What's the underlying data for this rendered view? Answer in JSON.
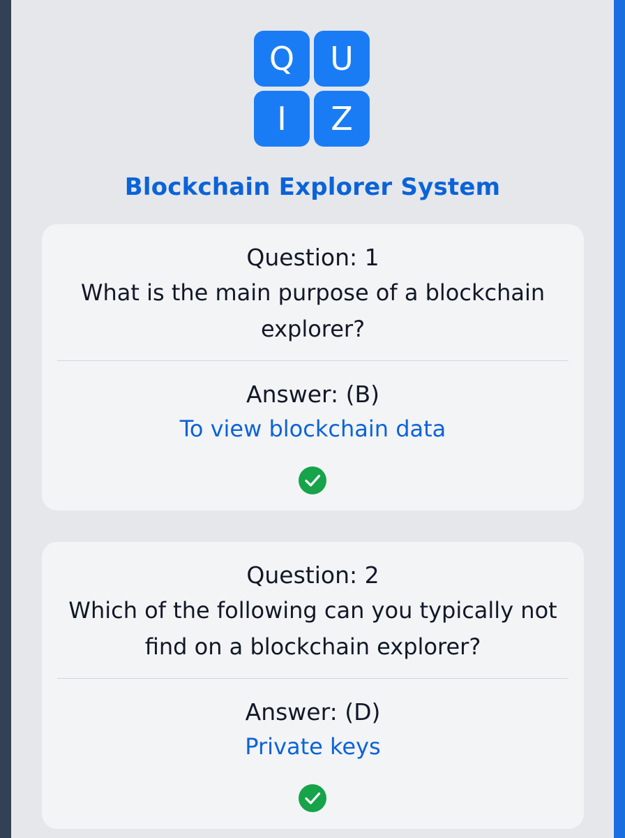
{
  "logo": {
    "letters": [
      "Q",
      "U",
      "I",
      "Z"
    ],
    "color": "#1a7cf5"
  },
  "app_title": "Blockchain Explorer System",
  "accent_color": "#0b63d8",
  "success_color": "#16a34a",
  "questions": [
    {
      "label": "Question: 1",
      "text": "What is the main purpose of a blockchain explorer?",
      "answer_label": "Answer: (B)",
      "answer_text": "To view blockchain data",
      "status_icon": "check-circle-icon"
    },
    {
      "label": "Question: 2",
      "text": "Which of the following can you typically not find on a blockchain explorer?",
      "answer_label": "Answer: (D)",
      "answer_text": "Private keys",
      "status_icon": "check-circle-icon"
    }
  ]
}
